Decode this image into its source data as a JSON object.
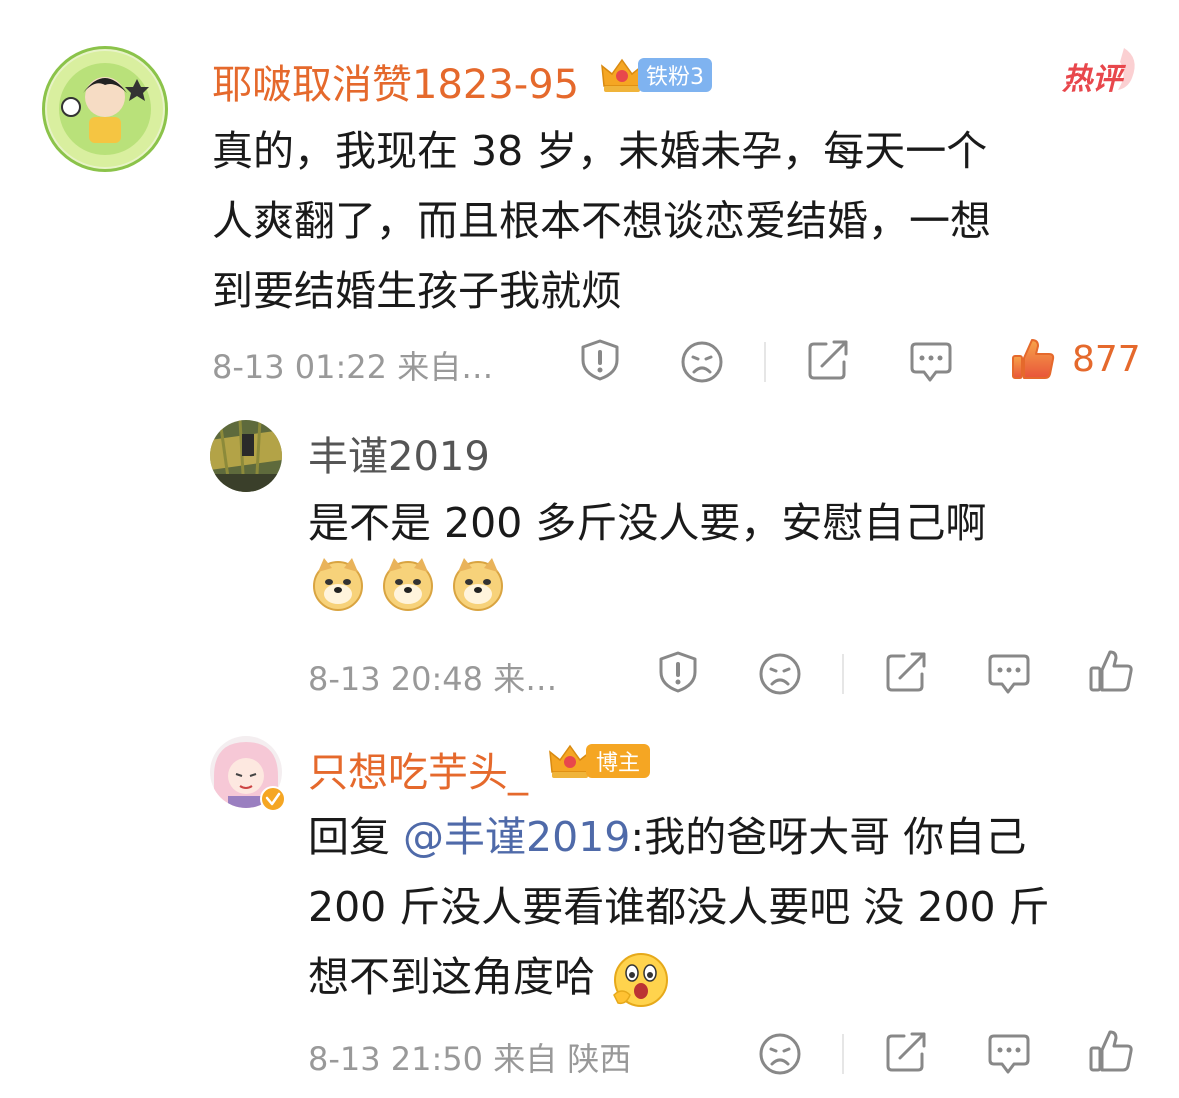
{
  "comment1": {
    "username": "耶啵取消赞1823-95",
    "badge": "铁粉3",
    "hot_tag": "热评",
    "text": "真的，我现在38岁，未婚未孕，每天一个人爽翻了，而且根本不想谈恋爱结婚，一想到要结婚生孩子我就烦",
    "lines": [
      "真的，我现在 38 岁，未婚未孕，每天一个",
      "人爽翻了，而且根本不想谈恋爱结婚，一想",
      "到要结婚生孩子我就烦"
    ],
    "meta": "8-13 01:22  来自…",
    "like_count": "877"
  },
  "reply1": {
    "username": "丰谨2019",
    "text": "是不是 200 多斤没人要，安慰自己啊",
    "emojis": [
      "doge-emoji",
      "doge-emoji",
      "doge-emoji"
    ],
    "meta": "8-13 20:48  来…"
  },
  "reply2": {
    "username": "只想吃芋头_",
    "badge": "博主",
    "prefix": "回复 ",
    "mention": "@丰谨2019",
    "lines": [
      ":我的爸呀大哥 你自己",
      " 200 斤没人要看谁都没人要吧 没 200 斤",
      "想不到这角度哈"
    ],
    "meta": "8-13 21:50  来自 陕西"
  },
  "colors": {
    "accent_orange": "#e5692c",
    "hot_red": "#e8474c",
    "mention_blue": "#4f6aa9",
    "badge_blue": "#7fb3f0",
    "badge_orange": "#f5a623",
    "meta_grey": "#999999"
  },
  "icons": [
    "report-icon",
    "dislike-face-icon",
    "share-icon",
    "comment-icon",
    "like-icon",
    "crown-icon",
    "verified-icon"
  ]
}
